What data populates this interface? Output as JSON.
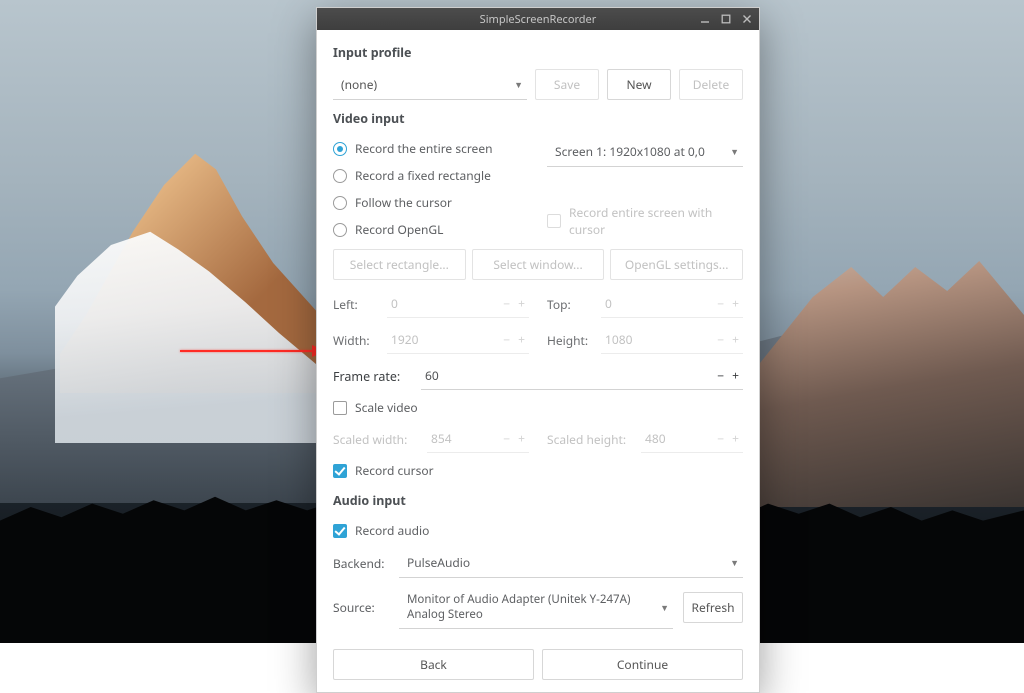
{
  "window": {
    "title": "SimpleScreenRecorder"
  },
  "input_profile": {
    "title": "Input profile",
    "selected": "(none)",
    "save": "Save",
    "new": "New",
    "delete": "Delete"
  },
  "video_input": {
    "title": "Video input",
    "options": {
      "entire_screen": "Record the entire screen",
      "fixed_rect": "Record a fixed rectangle",
      "follow_cursor": "Follow the cursor",
      "opengl": "Record OpenGL"
    },
    "screen_selected": "Screen 1: 1920x1080 at 0,0",
    "record_entire_with_cursor": "Record entire screen with cursor",
    "buttons": {
      "select_rect": "Select rectangle...",
      "select_win": "Select window...",
      "opengl_settings": "OpenGL settings..."
    },
    "left_label": "Left:",
    "left_value": "0",
    "top_label": "Top:",
    "top_value": "0",
    "width_label": "Width:",
    "width_value": "1920",
    "height_label": "Height:",
    "height_value": "1080",
    "framerate_label": "Frame rate:",
    "framerate_value": "60",
    "scale_video": "Scale video",
    "scaled_w_label": "Scaled width:",
    "scaled_w_value": "854",
    "scaled_h_label": "Scaled height:",
    "scaled_h_value": "480",
    "record_cursor": "Record cursor"
  },
  "audio_input": {
    "title": "Audio input",
    "record_audio": "Record audio",
    "backend_label": "Backend:",
    "backend_value": "PulseAudio",
    "source_label": "Source:",
    "source_value": "Monitor of Audio Adapter (Unitek Y-247A) Analog Stereo",
    "refresh": "Refresh"
  },
  "footer": {
    "back": "Back",
    "continue": "Continue"
  }
}
